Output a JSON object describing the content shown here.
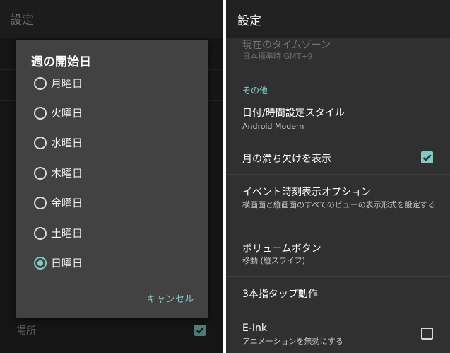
{
  "left": {
    "app_title": "設定",
    "bottom_label": "場所",
    "dialog": {
      "title": "週の開始日",
      "options": [
        {
          "label": "月曜日",
          "selected": false
        },
        {
          "label": "火曜日",
          "selected": false
        },
        {
          "label": "水曜日",
          "selected": false
        },
        {
          "label": "木曜日",
          "selected": false
        },
        {
          "label": "金曜日",
          "selected": false
        },
        {
          "label": "土曜日",
          "selected": false
        },
        {
          "label": "日曜日",
          "selected": true
        }
      ],
      "cancel_label": "キャンセル"
    }
  },
  "right": {
    "app_title": "設定",
    "timezone": {
      "title": "現在のタイムゾーン",
      "summary": "日本標準時  GMT+9"
    },
    "category_label": "その他",
    "date_style": {
      "title": "日付/時間設定スタイル",
      "summary": "Android Modern"
    },
    "moon_phase": {
      "title": "月の満ち欠けを表示",
      "checked": true
    },
    "event_time": {
      "title": "イベント時刻表示オプション",
      "summary": "横画面と縦画面のすべてのビューの表示形式を設定する"
    },
    "volume_button": {
      "title": "ボリュームボタン",
      "summary": "移動 (縦スワイプ)"
    },
    "three_finger": {
      "title": "3本指タップ動作"
    },
    "eink": {
      "title": "E-Ink",
      "summary": "アニメーションを無効にする",
      "checked": false
    }
  },
  "colors": {
    "accent": "#80cbc4",
    "left_background": "#151515",
    "dialog_background": "#424242",
    "right_background": "#303030",
    "header_background": "#212121"
  }
}
